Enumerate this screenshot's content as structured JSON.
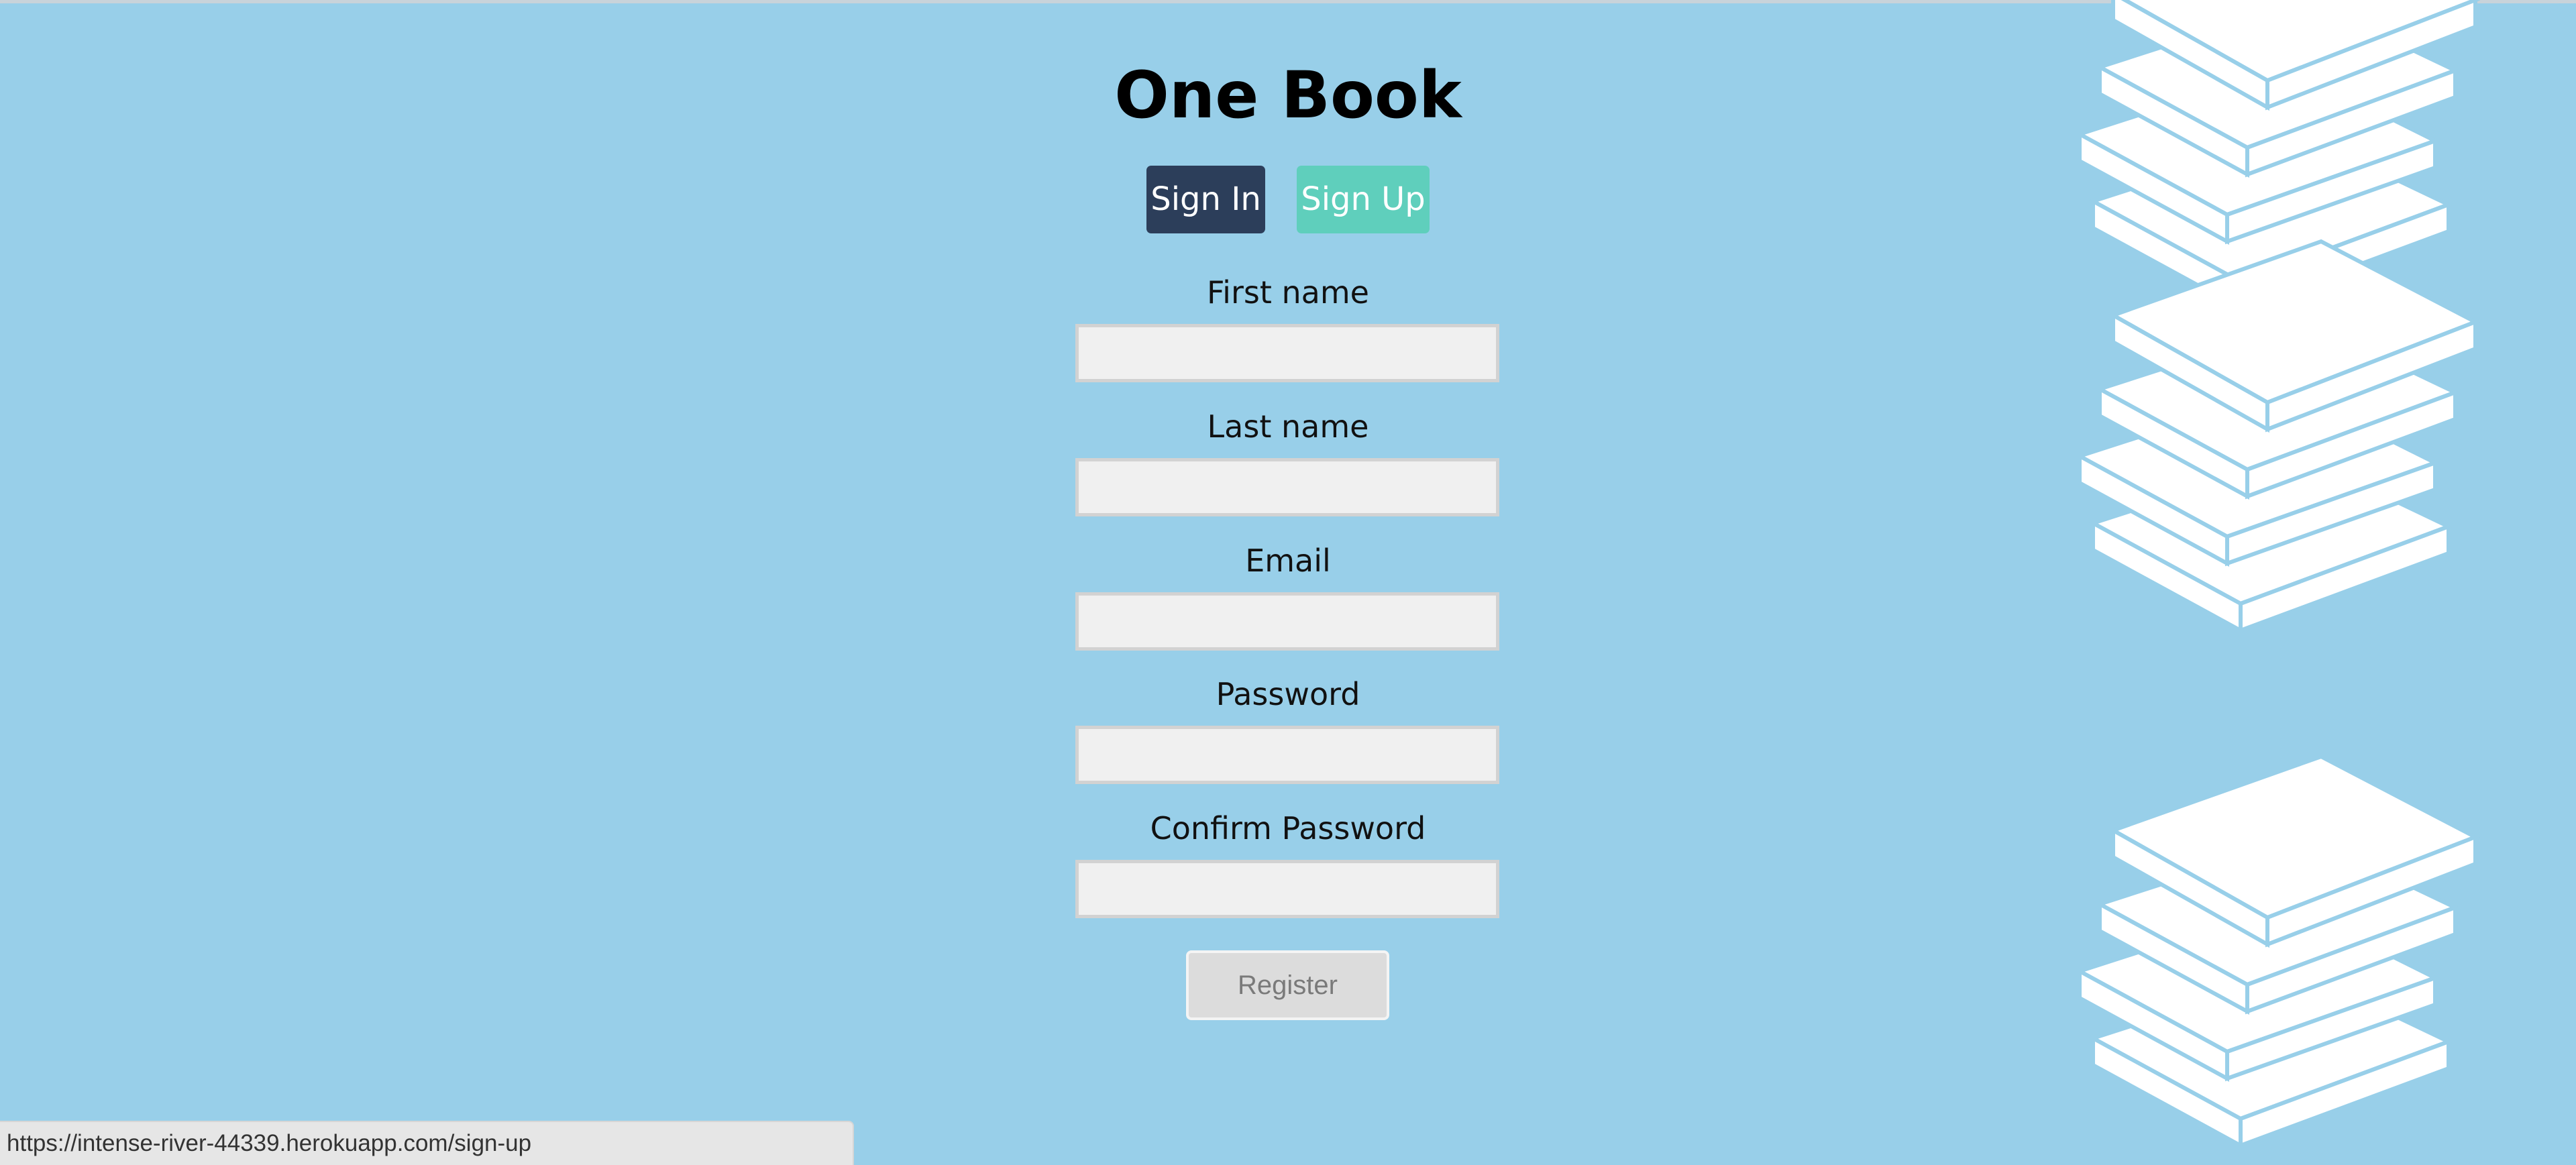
{
  "app": {
    "title": "One Book"
  },
  "tabs": {
    "signin_label": "Sign In",
    "signup_label": "Sign Up"
  },
  "form": {
    "fields": [
      {
        "label": "First name",
        "value": "",
        "placeholder": ""
      },
      {
        "label": "Last name",
        "value": "",
        "placeholder": ""
      },
      {
        "label": "Email",
        "value": "",
        "placeholder": ""
      },
      {
        "label": "Password",
        "value": "",
        "placeholder": ""
      },
      {
        "label": "Confirm Password",
        "value": "",
        "placeholder": ""
      }
    ],
    "register_label": "Register",
    "register_disabled": true
  },
  "decor": {
    "books_icon": "book-stack-icon",
    "books_count": 3
  },
  "status": {
    "url": "https://intense-river-44339.herokuapp.com/sign-up"
  },
  "colors": {
    "background": "#98cfe9",
    "signin_bg": "#2c3e5a",
    "signup_bg": "#5fcfbc",
    "input_bg": "#f0f0f0",
    "register_bg": "#dcdcdc"
  }
}
